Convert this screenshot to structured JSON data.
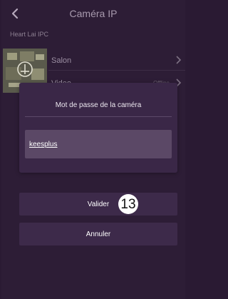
{
  "header": {
    "title": "Caméra IP",
    "back_icon": "chevron-left-icon"
  },
  "device": {
    "name": "Heart Lai IPC"
  },
  "cameras": [
    {
      "label": "Salon",
      "status": ""
    },
    {
      "label": "Video",
      "status": "Offline"
    }
  ],
  "dialog": {
    "title": "Mot de passe de la caméra",
    "password_value": "keesplus"
  },
  "buttons": {
    "validate_label": "Valider",
    "cancel_label": "Annuler"
  },
  "annotation": {
    "step_number": "13"
  },
  "colors": {
    "background": "#2d1d36",
    "dialog": "#3a2747",
    "field": "#5b4866",
    "button": "#3d2a4a",
    "title_text": "#a89aae"
  }
}
